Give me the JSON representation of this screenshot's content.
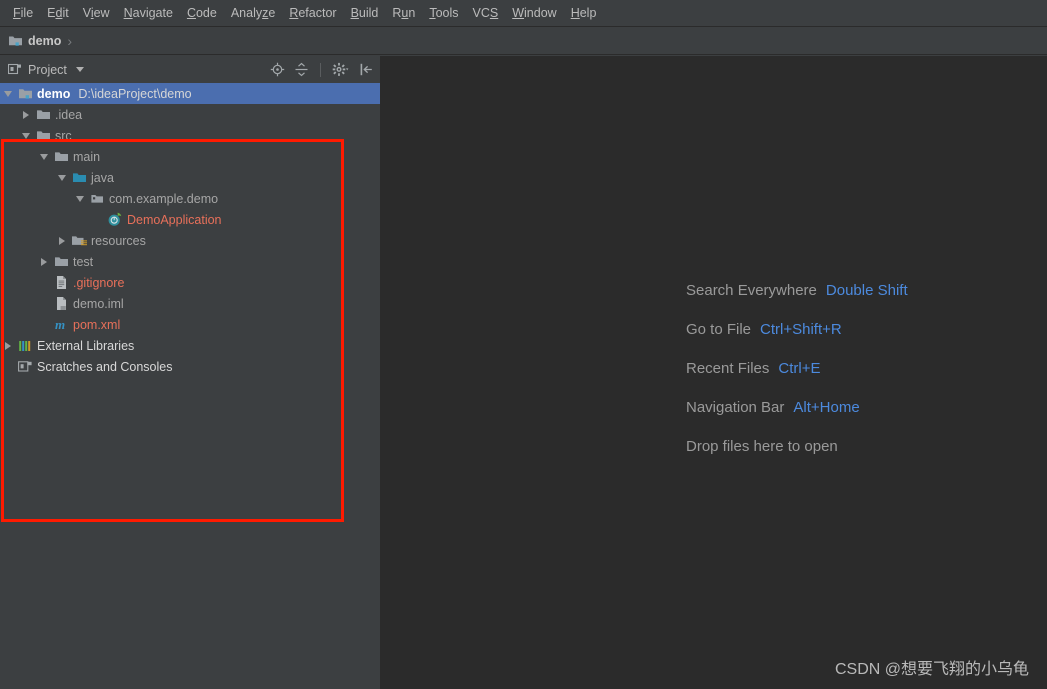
{
  "menubar": {
    "items": [
      {
        "label": "File",
        "mnemonic_index": 0
      },
      {
        "label": "Edit",
        "mnemonic_index": 1
      },
      {
        "label": "View",
        "mnemonic_index": 1
      },
      {
        "label": "Navigate",
        "mnemonic_index": 0
      },
      {
        "label": "Code",
        "mnemonic_index": 0
      },
      {
        "label": "Analyze",
        "mnemonic_index": 5
      },
      {
        "label": "Refactor",
        "mnemonic_index": 0
      },
      {
        "label": "Build",
        "mnemonic_index": 0
      },
      {
        "label": "Run",
        "mnemonic_index": 1
      },
      {
        "label": "Tools",
        "mnemonic_index": 0
      },
      {
        "label": "VCS",
        "mnemonic_index": 2
      },
      {
        "label": "Window",
        "mnemonic_index": 0
      },
      {
        "label": "Help",
        "mnemonic_index": 0
      }
    ]
  },
  "navbar": {
    "crumb_label": "demo",
    "separator": "›",
    "icon": "module-icon"
  },
  "sidebar": {
    "title": "Project",
    "title_icon": "project-view-icon",
    "dropdown_icon": "chevron-down-icon",
    "tools": [
      {
        "name": "locate-icon",
        "title": "Select Opened File"
      },
      {
        "name": "collapse-all-icon",
        "title": "Collapse All"
      },
      {
        "name": "settings-gear-icon",
        "title": "Show Options Menu"
      },
      {
        "name": "hide-panel-icon",
        "title": "Hide"
      }
    ],
    "tree": [
      {
        "label": "demo",
        "secondary": "D:\\ideaProject\\demo",
        "depth": 0,
        "arrow": "expanded",
        "icon": "module-icon",
        "style": "bold",
        "selected": true
      },
      {
        "label": ".idea",
        "secondary": "",
        "depth": 1,
        "arrow": "collapsed",
        "icon": "folder-icon",
        "style": "dim",
        "selected": false
      },
      {
        "label": "src",
        "secondary": "",
        "depth": 1,
        "arrow": "expanded",
        "icon": "folder-icon",
        "style": "dim",
        "selected": false
      },
      {
        "label": "main",
        "secondary": "",
        "depth": 2,
        "arrow": "expanded",
        "icon": "folder-icon",
        "style": "dim",
        "selected": false
      },
      {
        "label": "java",
        "secondary": "",
        "depth": 3,
        "arrow": "expanded",
        "icon": "source-folder-icon",
        "style": "dim",
        "selected": false
      },
      {
        "label": "com.example.demo",
        "secondary": "",
        "depth": 4,
        "arrow": "expanded",
        "icon": "package-icon",
        "style": "dim",
        "selected": false
      },
      {
        "label": "DemoApplication",
        "secondary": "",
        "depth": 5,
        "arrow": "none",
        "icon": "spring-boot-icon",
        "style": "red",
        "selected": false
      },
      {
        "label": "resources",
        "secondary": "",
        "depth": 3,
        "arrow": "collapsed",
        "icon": "resources-folder-icon",
        "style": "dim",
        "selected": false
      },
      {
        "label": "test",
        "secondary": "",
        "depth": 2,
        "arrow": "collapsed",
        "icon": "folder-icon",
        "style": "dim",
        "selected": false
      },
      {
        "label": ".gitignore",
        "secondary": "",
        "depth": 2,
        "arrow": "none",
        "icon": "text-file-icon",
        "style": "red",
        "selected": false
      },
      {
        "label": "demo.iml",
        "secondary": "",
        "depth": 2,
        "arrow": "none",
        "icon": "iml-file-icon",
        "style": "dim",
        "selected": false
      },
      {
        "label": "pom.xml",
        "secondary": "",
        "depth": 2,
        "arrow": "none",
        "icon": "maven-pom-icon",
        "style": "red",
        "selected": false
      },
      {
        "label": "External Libraries",
        "secondary": "",
        "depth": 0,
        "arrow": "collapsed",
        "icon": "libraries-icon",
        "style": "white",
        "selected": false
      },
      {
        "label": "Scratches and Consoles",
        "secondary": "",
        "depth": 0,
        "arrow": "none",
        "icon": "scratches-icon",
        "style": "white",
        "selected": false
      }
    ]
  },
  "editor": {
    "shortcuts": [
      {
        "name": "Search Everywhere",
        "key": "Double Shift"
      },
      {
        "name": "Go to File",
        "key": "Ctrl+Shift+R"
      },
      {
        "name": "Recent Files",
        "key": "Ctrl+E"
      },
      {
        "name": "Navigation Bar",
        "key": "Alt+Home"
      },
      {
        "name": "Drop files here to open",
        "key": ""
      }
    ],
    "watermark": "CSDN @想要飞翔的小乌龟"
  },
  "annotation": {
    "box_color": "#ff1a00"
  },
  "colors": {
    "panel_bg": "#3c3f41",
    "editor_bg": "#2b2b2b",
    "selection_blue": "#4b6eaf",
    "shortcut_key_blue": "#4c8ade",
    "vcs_red": "#e8705a"
  }
}
